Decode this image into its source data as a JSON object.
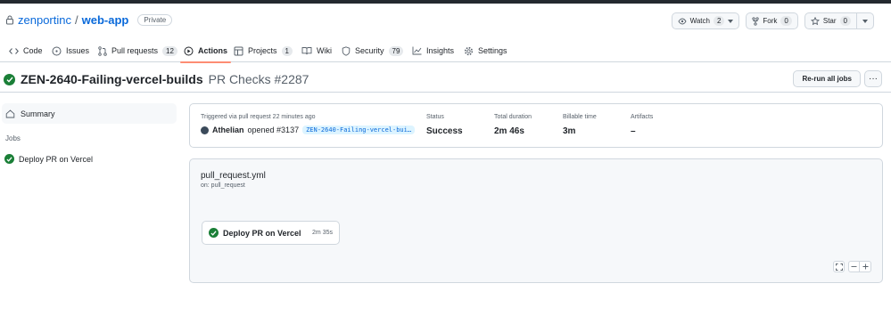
{
  "repo": {
    "owner": "zenportinc",
    "separator": "/",
    "name": "web-app",
    "visibility": "Private",
    "watch": {
      "label": "Watch",
      "count": "2"
    },
    "fork": {
      "label": "Fork",
      "count": "0"
    },
    "star": {
      "label": "Star",
      "count": "0"
    }
  },
  "nav": {
    "tabs": [
      {
        "label": "Code",
        "icon": "code-icon"
      },
      {
        "label": "Issues",
        "icon": "issue-icon"
      },
      {
        "label": "Pull requests",
        "count": "12",
        "icon": "pull-request-icon"
      },
      {
        "label": "Actions",
        "icon": "play-icon",
        "active": true
      },
      {
        "label": "Projects",
        "count": "1",
        "icon": "table-icon"
      },
      {
        "label": "Wiki",
        "icon": "book-icon"
      },
      {
        "label": "Security",
        "count": "79",
        "icon": "shield-icon"
      },
      {
        "label": "Insights",
        "icon": "graph-icon"
      },
      {
        "label": "Settings",
        "icon": "gear-icon"
      }
    ]
  },
  "run": {
    "title": "ZEN-2640-Failing-vercel-builds",
    "subtitle": "PR Checks #2287",
    "rerun_label": "Re-run all jobs",
    "more_label": "···"
  },
  "sidebar": {
    "summary_label": "Summary",
    "jobs_heading": "Jobs",
    "jobs": [
      {
        "label": "Deploy PR on Vercel"
      }
    ]
  },
  "summary": {
    "trigger_label": "Triggered via pull request 22 minutes ago",
    "user": "Athelian",
    "action": "opened #3137",
    "branch": "ZEN-2640-Failing-vercel-bui…",
    "status_label": "Status",
    "status": "Success",
    "duration_label": "Total duration",
    "duration": "2m 46s",
    "billable_label": "Billable time",
    "billable": "3m",
    "artifacts_label": "Artifacts",
    "artifacts": "–"
  },
  "workflow": {
    "file": "pull_request.yml",
    "on": "on: pull_request",
    "job_name": "Deploy PR on Vercel",
    "job_duration": "2m 35s"
  },
  "colors": {
    "success": "#1a7f37",
    "link": "#0969da",
    "active_tab": "#fd8c73"
  }
}
